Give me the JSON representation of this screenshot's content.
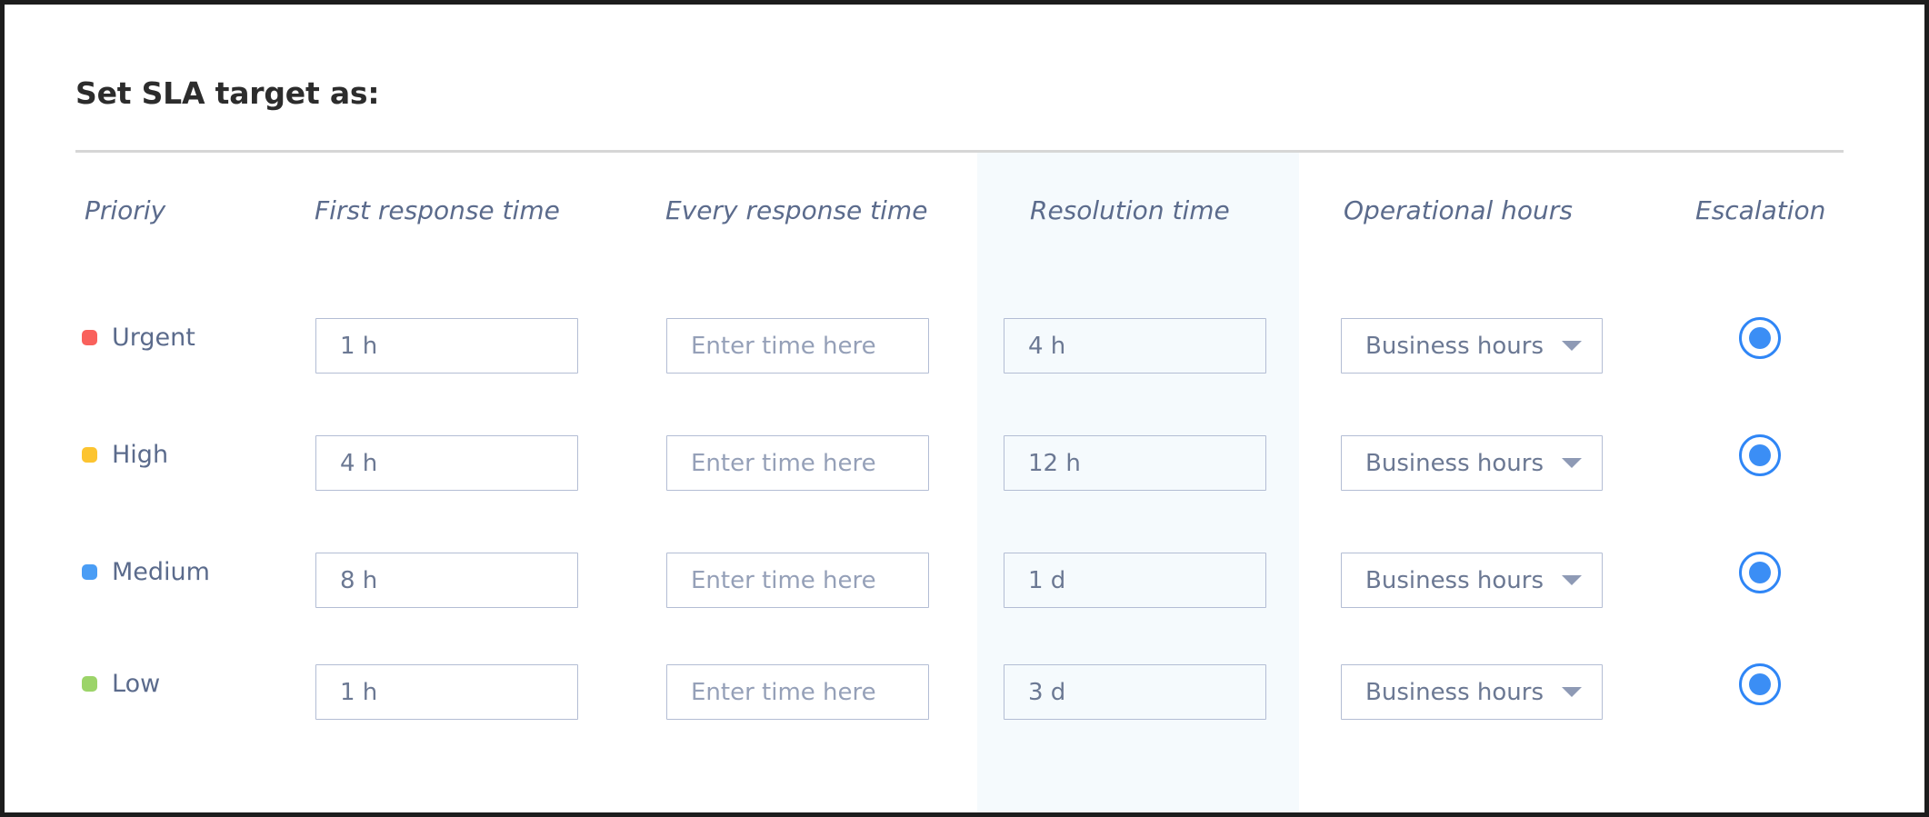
{
  "page": {
    "title": "Set SLA target as:"
  },
  "table": {
    "columns": [
      {
        "key": "priority",
        "label": "Prioriy"
      },
      {
        "key": "first",
        "label": "First response time"
      },
      {
        "key": "every",
        "label": "Every response time"
      },
      {
        "key": "resolution",
        "label": "Resolution time"
      },
      {
        "key": "operational",
        "label": "Operational hours"
      },
      {
        "key": "escalation",
        "label": "Escalation"
      }
    ],
    "highlighted_column": "resolution",
    "rows": [
      {
        "priority": "Urgent",
        "priority_color": "#f9615c",
        "first_response_time": "1 h",
        "every_response_placeholder": "Enter time here",
        "every_response_value": "",
        "resolution_time": "4 h",
        "operational_hours": "Business hours",
        "escalation_selected": true
      },
      {
        "priority": "High",
        "priority_color": "#fcc430",
        "first_response_time": "4 h",
        "every_response_placeholder": "Enter time here",
        "every_response_value": "",
        "resolution_time": "12 h",
        "operational_hours": "Business hours",
        "escalation_selected": true
      },
      {
        "priority": "Medium",
        "priority_color": "#4a9df5",
        "first_response_time": "8 h",
        "every_response_placeholder": "Enter time here",
        "every_response_value": "",
        "resolution_time": "1 d",
        "operational_hours": "Business hours",
        "escalation_selected": true
      },
      {
        "priority": "Low",
        "priority_color": "#9cd469",
        "first_response_time": "1 h",
        "every_response_placeholder": "Enter time here",
        "every_response_value": "",
        "resolution_time": "3 d",
        "operational_hours": "Business hours",
        "escalation_selected": true
      }
    ]
  },
  "colors": {
    "accent": "#3b8ef5",
    "highlight_column_bg": "#f5fafd",
    "header_text": "#5b6b8c",
    "field_border": "#b3bdd4",
    "divider": "#d6d6d6",
    "title_text": "#2c2c2c"
  },
  "icons": {
    "dropdown_caret": "chevron-down-icon",
    "radio": "radio-selected-icon"
  }
}
